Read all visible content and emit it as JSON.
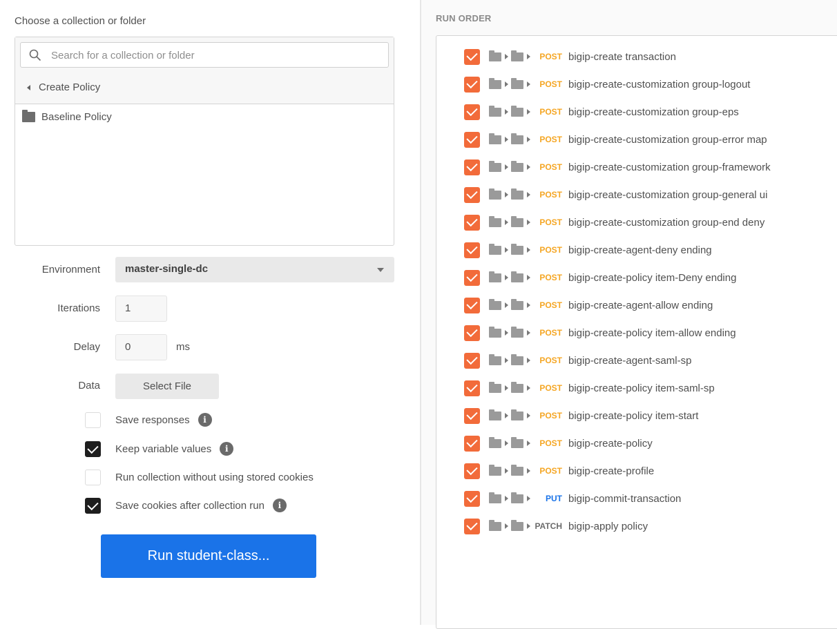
{
  "left_panel": {
    "choose_label": "Choose a collection or folder",
    "search_placeholder": "Search for a collection or folder",
    "breadcrumb": "Create Policy",
    "folder": "Baseline Policy",
    "environment": {
      "label": "Environment",
      "value": "master-single-dc"
    },
    "iterations": {
      "label": "Iterations",
      "value": "1"
    },
    "delay": {
      "label": "Delay",
      "value": "0",
      "unit": "ms"
    },
    "data": {
      "label": "Data",
      "button": "Select File"
    },
    "options": [
      {
        "label": "Save responses",
        "checked": false,
        "info": true
      },
      {
        "label": "Keep variable values",
        "checked": true,
        "info": true
      },
      {
        "label": "Run collection without using stored cookies",
        "checked": false,
        "info": false
      },
      {
        "label": "Save cookies after collection run",
        "checked": true,
        "info": true
      }
    ],
    "run_button": "Run student-class..."
  },
  "run_order": {
    "title": "RUN ORDER",
    "requests": [
      {
        "method": "POST",
        "name": "bigip-create transaction"
      },
      {
        "method": "POST",
        "name": "bigip-create-customization group-logout"
      },
      {
        "method": "POST",
        "name": "bigip-create-customization group-eps"
      },
      {
        "method": "POST",
        "name": "bigip-create-customization group-error map"
      },
      {
        "method": "POST",
        "name": "bigip-create-customization group-framework"
      },
      {
        "method": "POST",
        "name": "bigip-create-customization group-general ui"
      },
      {
        "method": "POST",
        "name": "bigip-create-customization group-end deny"
      },
      {
        "method": "POST",
        "name": "bigip-create-agent-deny ending"
      },
      {
        "method": "POST",
        "name": "bigip-create-policy item-Deny ending"
      },
      {
        "method": "POST",
        "name": "bigip-create-agent-allow ending"
      },
      {
        "method": "POST",
        "name": "bigip-create-policy item-allow ending"
      },
      {
        "method": "POST",
        "name": "bigip-create-agent-saml-sp"
      },
      {
        "method": "POST",
        "name": "bigip-create-policy item-saml-sp"
      },
      {
        "method": "POST",
        "name": "bigip-create-policy item-start"
      },
      {
        "method": "POST",
        "name": "bigip-create-policy"
      },
      {
        "method": "POST",
        "name": "bigip-create-profile"
      },
      {
        "method": "PUT",
        "name": "bigip-commit-transaction"
      },
      {
        "method": "PATCH",
        "name": "bigip-apply policy"
      }
    ]
  },
  "colors": {
    "accent": "#1a73e8",
    "checkbox": "#f26b3a",
    "post": "#f5a623",
    "put": "#1a73e8"
  }
}
